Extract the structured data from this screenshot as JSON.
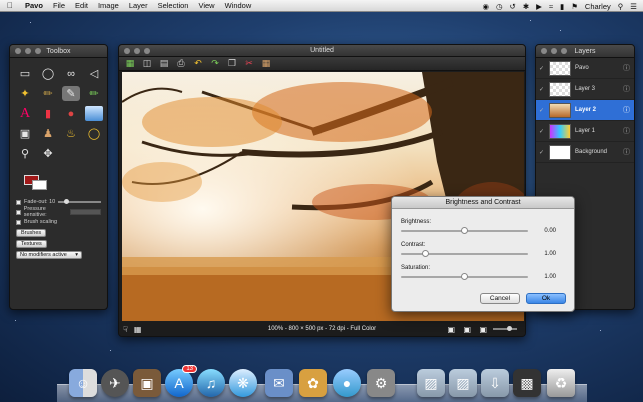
{
  "menubar": {
    "app": "Pavo",
    "menus": [
      "File",
      "Edit",
      "Image",
      "Layer",
      "Selection",
      "View",
      "Window"
    ],
    "user": "Charley"
  },
  "toolbox": {
    "title": "Toolbox",
    "tools": [
      "rect-select",
      "ellipse-select",
      "lasso",
      "lasso-poly",
      "magic-wand",
      "brush",
      "smudge",
      "pencil",
      "text",
      "eraser",
      "color-picker",
      "gradient",
      "crop",
      "stamp",
      "bucket",
      "ring",
      "zoom",
      "move"
    ],
    "fade_out_label": "Fade-out: 10",
    "pressure_label": "Pressure sensitive:",
    "brush_scaling_label": "Brush scaling",
    "brushes_button": "Brushes",
    "textures_button": "Textures",
    "modifiers_popup": "No modifiers active",
    "foreground_color": "#a01818",
    "background_color": "#ffffff"
  },
  "document": {
    "title": "Untitled",
    "status": "100% - 800 × 500 px - 72 dpi - Full Color"
  },
  "layers": {
    "title": "Layers",
    "items": [
      {
        "name": "Pavo",
        "selected": false
      },
      {
        "name": "Layer 3",
        "selected": false
      },
      {
        "name": "Layer 2",
        "selected": true
      },
      {
        "name": "Layer 1",
        "selected": false
      },
      {
        "name": "Background",
        "selected": false
      }
    ]
  },
  "dialog": {
    "title": "Brightness and Contrast",
    "brightness_label": "Brightness:",
    "brightness_value": "0.00",
    "contrast_label": "Contrast:",
    "contrast_value": "1.00",
    "saturation_label": "Saturation:",
    "saturation_value": "1.00",
    "cancel_label": "Cancel",
    "ok_label": "Ok"
  },
  "dock": {
    "appstore_badge": "13"
  }
}
